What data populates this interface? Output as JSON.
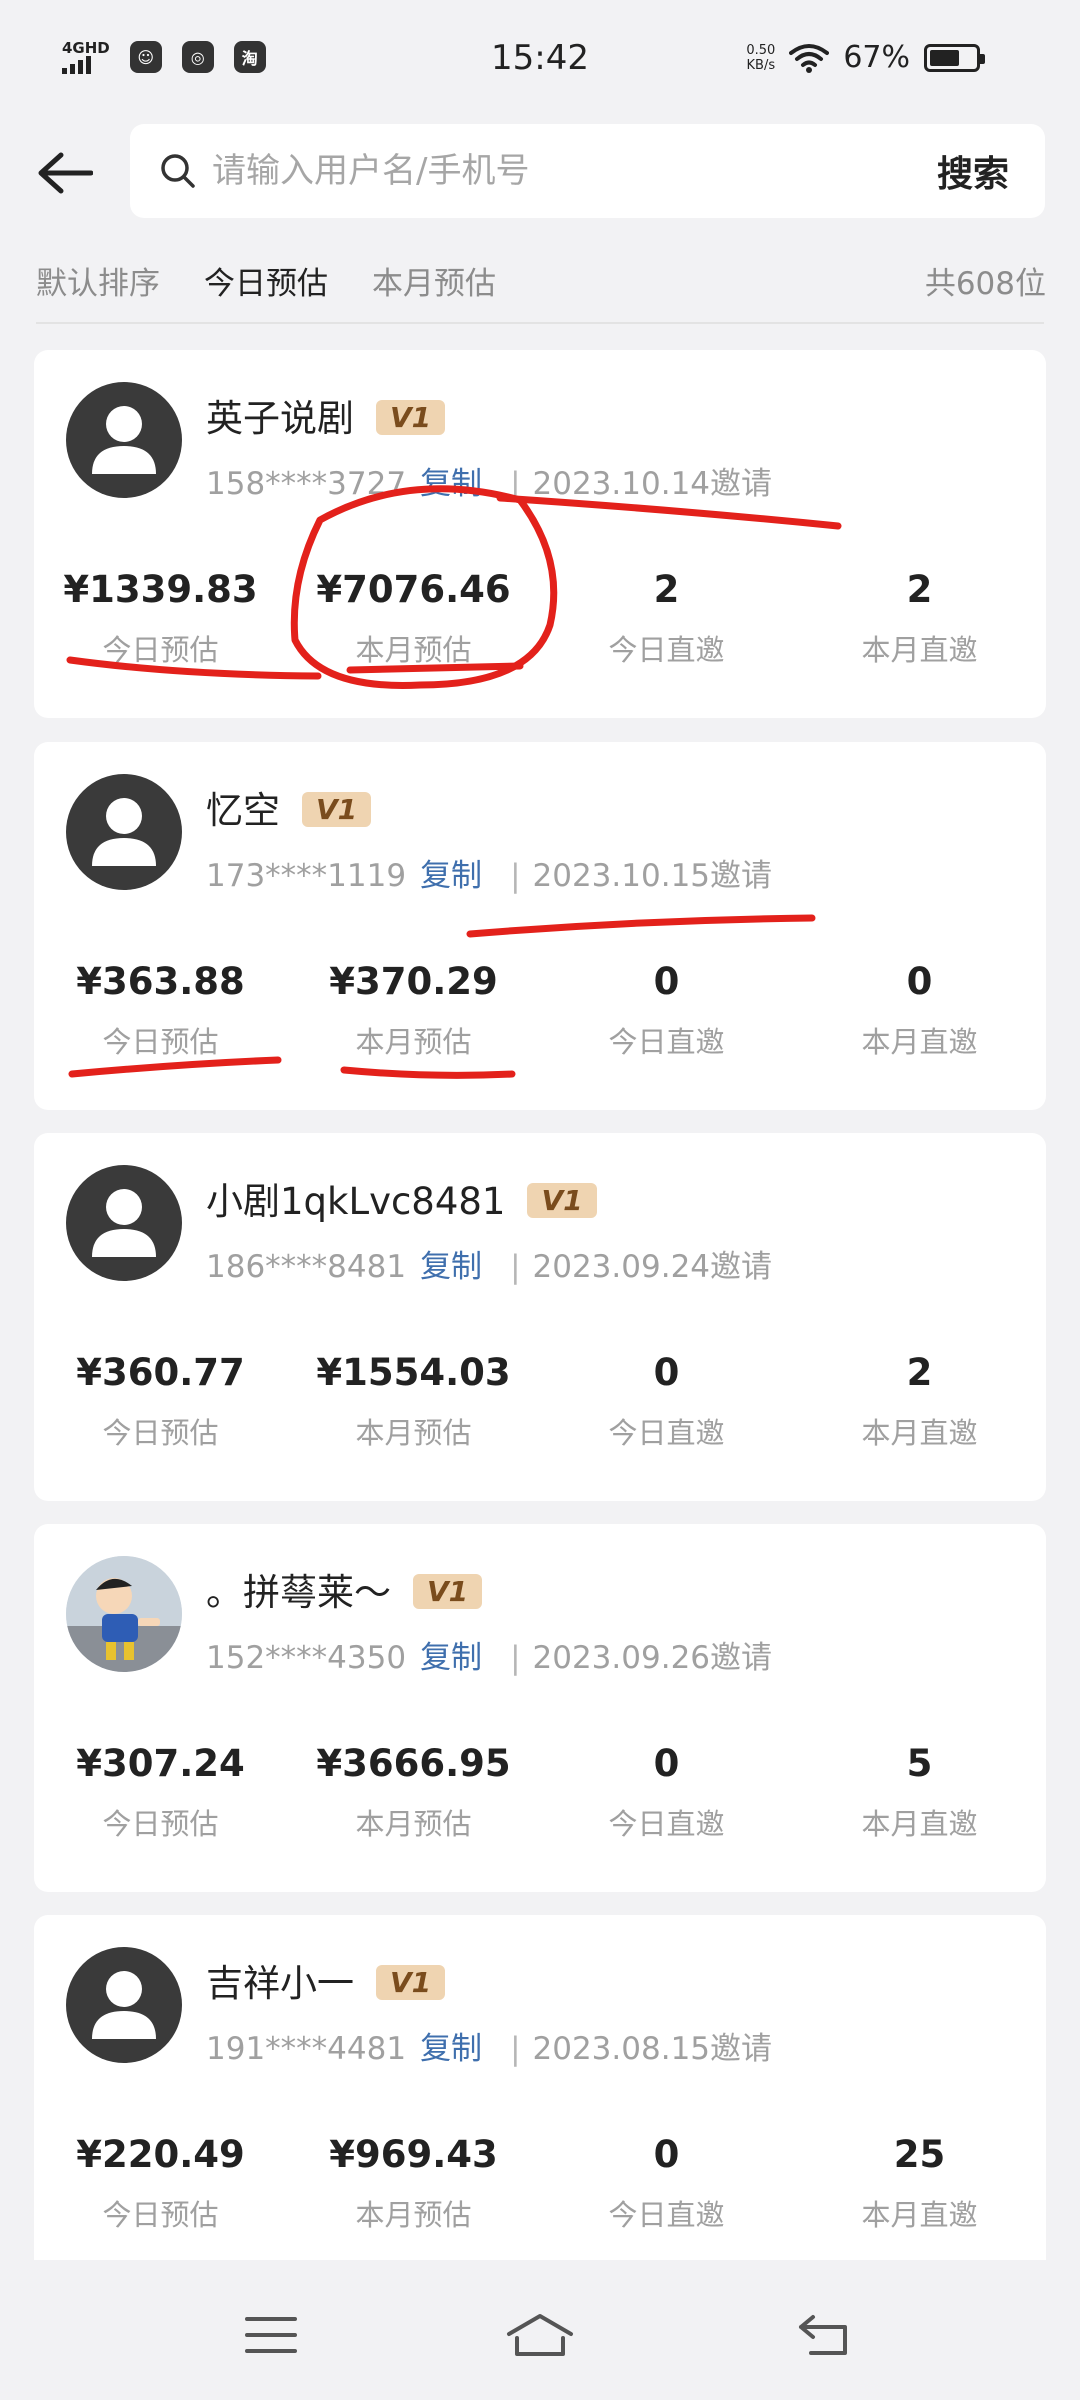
{
  "status_bar": {
    "network": "4GHD",
    "app_icons": [
      "qq-icon",
      "browser-icon",
      "taobao-icon"
    ],
    "time": "15:42",
    "speed_value": "0.50",
    "speed_unit": "KB/s",
    "battery_pct": "67%",
    "battery_level": 0.67
  },
  "search": {
    "placeholder": "请输入用户名/手机号",
    "button_label": "搜索"
  },
  "sort_tabs": [
    {
      "label": "默认排序",
      "active": false
    },
    {
      "label": "今日预估",
      "active": true
    },
    {
      "label": "本月预估",
      "active": false
    }
  ],
  "total_count": "共608位",
  "accent": {
    "badge_bg": "#efd4b1",
    "badge_text": "#7a4c1d",
    "copy_link": "#3f6fad",
    "marker": "#e3211b"
  },
  "users": [
    {
      "name": "英子说剧",
      "level": "V1",
      "phone": "158****3727",
      "copy_label": "复制",
      "invited": "2023.10.14邀请",
      "avatar": "default-avatar",
      "stats": [
        {
          "value": "¥1339.83",
          "label": "今日预估"
        },
        {
          "value": "¥7076.46",
          "label": "本月预估"
        },
        {
          "value": "2",
          "label": "今日直邀"
        },
        {
          "value": "2",
          "label": "本月直邀"
        }
      ]
    },
    {
      "name": "忆空",
      "level": "V1",
      "phone": "173****1119",
      "copy_label": "复制",
      "invited": "2023.10.15邀请",
      "avatar": "default-avatar",
      "stats": [
        {
          "value": "¥363.88",
          "label": "今日预估"
        },
        {
          "value": "¥370.29",
          "label": "本月预估"
        },
        {
          "value": "0",
          "label": "今日直邀"
        },
        {
          "value": "0",
          "label": "本月直邀"
        }
      ]
    },
    {
      "name": "小剧1qkLvc8481",
      "level": "V1",
      "phone": "186****8481",
      "copy_label": "复制",
      "invited": "2023.09.24邀请",
      "avatar": "default-avatar",
      "stats": [
        {
          "value": "¥360.77",
          "label": "今日预估"
        },
        {
          "value": "¥1554.03",
          "label": "本月预估"
        },
        {
          "value": "0",
          "label": "今日直邀"
        },
        {
          "value": "2",
          "label": "本月直邀"
        }
      ]
    },
    {
      "name": "。拼䔢莱～",
      "level": "V1",
      "phone": "152****4350",
      "copy_label": "复制",
      "invited": "2023.09.26邀请",
      "avatar": "cartoon-avatar",
      "stats": [
        {
          "value": "¥307.24",
          "label": "今日预估"
        },
        {
          "value": "¥3666.95",
          "label": "本月预估"
        },
        {
          "value": "0",
          "label": "今日直邀"
        },
        {
          "value": "5",
          "label": "本月直邀"
        }
      ]
    },
    {
      "name": "吉祥小一",
      "level": "V1",
      "phone": "191****4481",
      "copy_label": "复制",
      "invited": "2023.08.15邀请",
      "avatar": "default-avatar",
      "stats": [
        {
          "value": "¥220.49",
          "label": "今日预估"
        },
        {
          "value": "¥969.43",
          "label": "本月预估"
        },
        {
          "value": "0",
          "label": "今日直邀"
        },
        {
          "value": "25",
          "label": "本月直邀"
        }
      ]
    }
  ]
}
